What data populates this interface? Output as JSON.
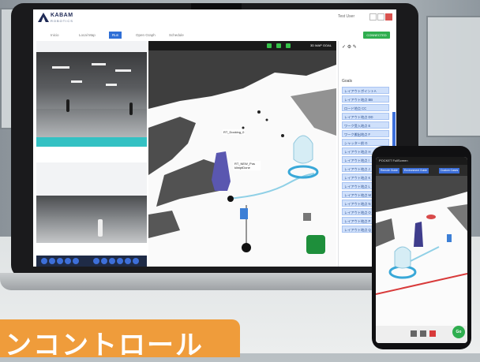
{
  "app": {
    "logo_text": "KABAM",
    "logo_sub": "ROBOTICS",
    "user_label": "Test User",
    "connect_label": "CONNECTED",
    "nav_tabs": [
      "Inicio",
      "Local Map",
      "Run",
      "Open Graph",
      "Schedule"
    ],
    "active_tab_index": 2
  },
  "view3d": {
    "toolbar_text": "3D  MAP  GOAL",
    "labels": [
      "RT_Docking_0",
      "RT_NEW_Pos kliniptDone"
    ]
  },
  "right_panel": {
    "header": "Goals",
    "items": [
      "レイアウトボイントA",
      "レイアウト地点 BB",
      "ロード地点 CC",
      "レイアウト地点 DD",
      "ワーク受入地点 E",
      "ワーク搬出地点 F",
      "シャッター前 G",
      "レイアウト地点 H",
      "レイアウト地点 I",
      "レイアウト地点 J",
      "レイアウト地点 K",
      "レイアウト地点 L",
      "レイアウト地点 M",
      "レイアウト地点 N",
      "レイアウト地点 O",
      "レイアウト地点 P",
      "レイアウト地点 Q"
    ]
  },
  "phone": {
    "status_text": "POCKET  FullScreen",
    "tabs": [
      "Remote Guide",
      "Environment Guide",
      "Custom Cases"
    ],
    "go_label": "Go"
  },
  "banner": {
    "text": "ンコントロール"
  },
  "colors": {
    "accent_blue": "#3d6fd9",
    "accent_green": "#2fae4f",
    "banner_orange": "#ef9c3b",
    "teal": "#34c1c3"
  }
}
